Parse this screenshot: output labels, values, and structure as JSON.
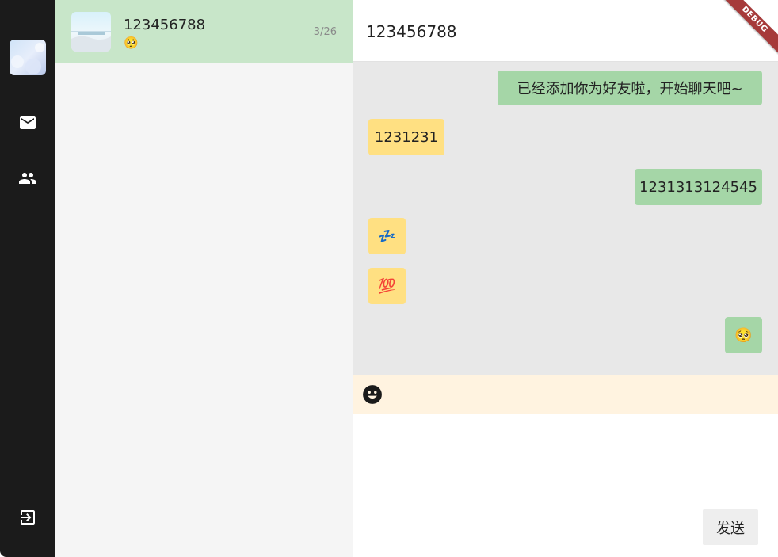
{
  "sidebar": {
    "avatar_alt": "user-avatar",
    "nav": [
      {
        "icon": "mail-icon"
      },
      {
        "icon": "people-icon"
      }
    ],
    "logout_icon": "logout-icon"
  },
  "conversations": [
    {
      "name": "123456788",
      "preview": "🥺",
      "date": "3/26",
      "selected": true
    }
  ],
  "chat": {
    "title": "123456788",
    "messages": [
      {
        "from": "me",
        "text": "已经添加你为好友啦，开始聊天吧~"
      },
      {
        "from": "other",
        "text": "1231231"
      },
      {
        "from": "me",
        "text": "1231313124545"
      },
      {
        "from": "other",
        "text": "💤"
      },
      {
        "from": "other",
        "text": "💯"
      },
      {
        "from": "me",
        "text": "🥺"
      }
    ],
    "emoji_icon": "emoji-icon",
    "input_value": "",
    "send_label": "发送"
  },
  "debug_banner": "DEBUG",
  "colors": {
    "rail_bg": "#1b1b1b",
    "list_bg": "#f5f5f5",
    "selected_item": "#c8e6c9",
    "messages_bg": "#e8e8e8",
    "my_bubble": "#a5d6a7",
    "other_bubble": "#ffe082",
    "toolbar_bg": "#fff3e0",
    "send_button_bg": "#eeeeee",
    "debug_ribbon": "#a63a3a"
  }
}
